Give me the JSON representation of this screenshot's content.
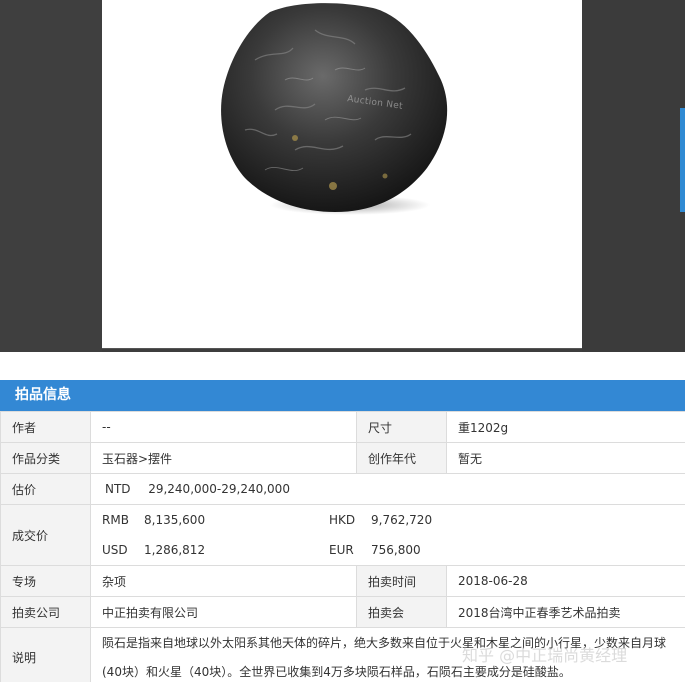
{
  "viewer": {
    "image_alt": "Meteorite",
    "watermark": "Auction Net"
  },
  "lot_info": {
    "header": "拍品信息",
    "rows": {
      "artist_label": "作者",
      "artist_value": "--",
      "size_label": "尺寸",
      "size_value": "重1202g",
      "category_label": "作品分类",
      "category_value": "玉石器>摆件",
      "year_label": "创作年代",
      "year_value": "暂无",
      "estimate_label": "估价",
      "estimate_currency": "NTD",
      "estimate_value": "29,240,000-29,240,000",
      "price_label": "成交价",
      "price_rmb_label": "RMB",
      "price_rmb_value": "8,135,600",
      "price_hkd_label": "HKD",
      "price_hkd_value": "9,762,720",
      "price_usd_label": "USD",
      "price_usd_value": "1,286,812",
      "price_eur_label": "EUR",
      "price_eur_value": "756,800",
      "session_label": "专场",
      "session_value": "杂项",
      "auction_time_label": "拍卖时间",
      "auction_time_value": "2018-06-28",
      "company_label": "拍卖公司",
      "company_value": "中正拍卖有限公司",
      "auction_label": "拍卖会",
      "auction_value": "2018台湾中正春季艺术品拍卖",
      "description_label": "说明",
      "description_value": "陨石是指来自地球以外太阳系其他天体的碎片，绝大多数来自位于火星和木星之间的小行星，少数来自月球(40块）和火星（40块）。全世界已收集到4万多块陨石样品，石陨石主要成分是硅酸盐。"
    }
  },
  "page_watermark": "知乎 @中正瑞尚黄经理",
  "colors": {
    "header_bg": "#3388d4",
    "label_bg": "#f3f3f3",
    "estimate_red": "#d0191b",
    "viewer_bg": "#3d3d3d"
  }
}
